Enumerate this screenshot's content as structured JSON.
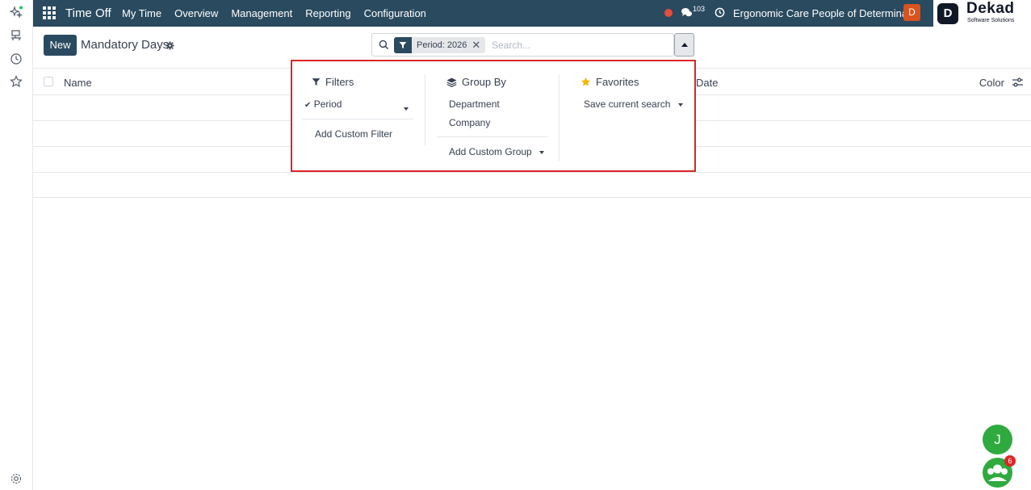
{
  "navbar": {
    "app_title": "Time Off",
    "menu": [
      "My Time",
      "Overview",
      "Management",
      "Reporting",
      "Configuration"
    ],
    "chat_count": "103",
    "company": "Ergonomic Care People of Determina...",
    "user_initial": "D"
  },
  "brand": {
    "logo_letter": "D",
    "name": "Dekad",
    "tagline": "Software Solutions"
  },
  "control": {
    "new_label": "New",
    "title": "Mandatory Days"
  },
  "search": {
    "facet_label": "Period: 2026",
    "facet_close": "✕",
    "placeholder": "Search..."
  },
  "list": {
    "columns": {
      "name": "Name",
      "date": "Date",
      "color": "Color"
    },
    "empty_rows": 4
  },
  "dropdown": {
    "filters": {
      "heading": "Filters",
      "items": [
        "Period"
      ],
      "custom": "Add Custom Filter"
    },
    "group_by": {
      "heading": "Group By",
      "items": [
        "Department",
        "Company"
      ],
      "custom": "Add Custom Group"
    },
    "favorites": {
      "heading": "Favorites",
      "save": "Save current search"
    }
  },
  "floating": {
    "user_initial": "J",
    "badge_count": "6"
  },
  "colors": {
    "navbar": "#2a4a5f",
    "highlight_border": "#dc2626",
    "fab": "#2eaa3f",
    "star": "#f5b301"
  }
}
